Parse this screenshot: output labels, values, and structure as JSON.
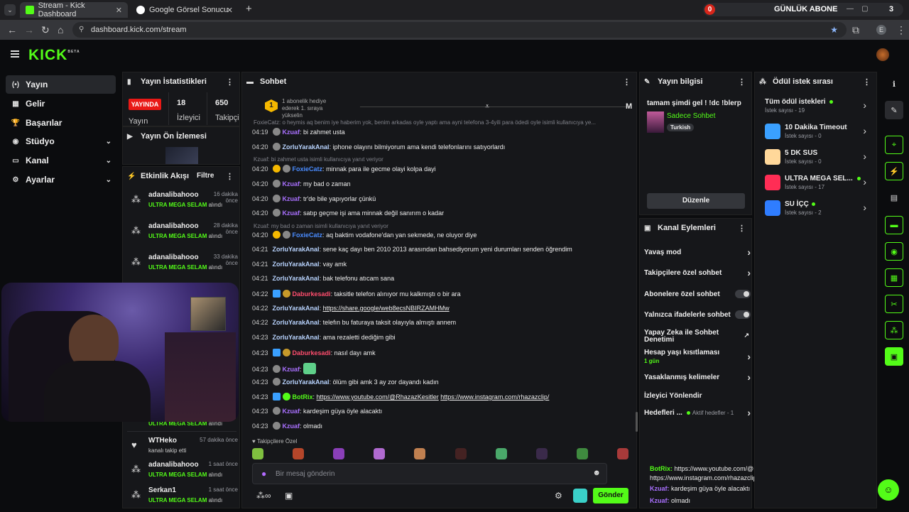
{
  "browser": {
    "tabs": [
      {
        "label": "Stream - Kick Dashboard",
        "close": "✕"
      },
      {
        "label": "Google Görsel Sonucu",
        "close": "✕"
      }
    ],
    "new_tab": "+",
    "goal_counter": "0",
    "goal_label": "GÜNLÜK ABONE",
    "goal_value": "3",
    "url": "dashboard.kick.com/stream",
    "profile_initial": "E"
  },
  "kick": {
    "logo": "KICK",
    "logo_sup": "BETA"
  },
  "leftnav": {
    "items": [
      {
        "label": "Yayın",
        "icon": "(•)",
        "chevron": ""
      },
      {
        "label": "Gelir",
        "icon": "▦",
        "chevron": ""
      },
      {
        "label": "Başarılar",
        "icon": "🏆",
        "chevron": ""
      },
      {
        "label": "Stüdyo",
        "icon": "◉",
        "chevron": "⌄"
      },
      {
        "label": "Kanal",
        "icon": "▭",
        "chevron": "⌄"
      },
      {
        "label": "Ayarlar",
        "icon": "⚙",
        "chevron": "⌄"
      }
    ]
  },
  "stats": {
    "title": "Yayın İstatistikleri",
    "live_badge": "YAYINDA",
    "live_label": "Yayın",
    "viewers": "18",
    "viewers_label": "İzleyici",
    "followers": "650",
    "followers_label": "Takipçi"
  },
  "preview": {
    "title": "Yayın Ön İzlemesi"
  },
  "activity": {
    "title": "Etkinlik Akışı",
    "filter": "Filtre",
    "items": [
      {
        "user": "adanalibahooo",
        "time": "16 dakika önce",
        "reward": "ULTRA MEGA SELAM",
        "suffix": " alındı"
      },
      {
        "user": "adanalibahooo",
        "time": "28 dakika önce",
        "reward": "ULTRA MEGA SELAM",
        "suffix": " alındı"
      },
      {
        "user": "adanalibahooo",
        "time": "33 dakika önce",
        "reward": "ULTRA MEGA SELAM",
        "suffix": " alındı"
      }
    ],
    "partial_reward": "ULTRA MEGA SELAM",
    "partial_suffix": " alındı",
    "follow": {
      "user": "WTHeko",
      "time": "57 dakika önce",
      "text": "kanalı takip etti"
    },
    "items2": [
      {
        "user": "adanalibahooo",
        "time": "1 saat önce",
        "reward": "ULTRA MEGA SELAM",
        "suffix": " alındı"
      },
      {
        "user": "Serkan1",
        "time": "1 saat önce",
        "reward": "ULTRA MEGA SELAM",
        "suffix": " alındı"
      }
    ]
  },
  "chat": {
    "title": "Sohbet",
    "pinned": {
      "rank": "1",
      "text": "1 abonelik hediye ederek 1. sıraya yükselin",
      "letter": "M"
    },
    "top_reply": "FoxieCatz: o heymis aq benim iye haberim yok, benim arkadas oyle yaptı ama ayni telefona 3-4yili para ödedi oyle isimli kullanıcıya ye...",
    "lines": [
      {
        "time": "04:19",
        "user": "Kzuaf",
        "color": "#a970ff",
        "text": "bi zahmet usta"
      },
      {
        "time": "04:20",
        "user": "ZorluYarakAnal",
        "color": "#b9d4ff",
        "text": "iphone olayını bilmiyorum ama kendi telefonlarını satıyorlardı"
      },
      {
        "time": "04:20",
        "user": "FoxieCatz",
        "color": "#4a8cff",
        "text": "minnak para ile gecme olayi kolpa dayi",
        "reply": "Kzuaf: bi zahmet usta isimli kullanıcıya yanıt veriyor"
      },
      {
        "time": "04:20",
        "user": "Kzuaf",
        "color": "#a970ff",
        "text": "my bad o zaman"
      },
      {
        "time": "04:20",
        "user": "Kzuaf",
        "color": "#a970ff",
        "text": "tr'de bile yapıyorlar çünkü"
      },
      {
        "time": "04:20",
        "user": "Kzuaf",
        "color": "#a970ff",
        "text": "satıp geçme işi ama minnak değil sanırım o kadar"
      },
      {
        "time": "04:20",
        "user": "FoxieCatz",
        "color": "#4a8cff",
        "text": "aq baktim vodafone'dan yan sekmede, ne oluyor diye",
        "reply": "Kzuaf: my bad o zaman isimli kullanıcıya yanıt veriyor"
      },
      {
        "time": "04:21",
        "user": "ZorluYarakAnal",
        "color": "#b9d4ff",
        "text": "sene kaç dayı ben 2010 2013 arasından bahsediyorum yeni durumları senden öğrendim"
      },
      {
        "time": "04:21",
        "user": "ZorluYarakAnal",
        "color": "#b9d4ff",
        "text": "vay amk"
      },
      {
        "time": "04:21",
        "user": "ZorluYarakAnal",
        "color": "#b9d4ff",
        "text": "bak telefonu atıcam sana"
      },
      {
        "time": "04:22",
        "user": "Daburkesadi",
        "color": "#ff4d6d",
        "text": "taksitle telefon alınıyor mu kalkmıştı o bir ara"
      },
      {
        "time": "04:22",
        "user": "ZorluYarakAnal",
        "color": "#b9d4ff",
        "text": "",
        "link": "https://share.google/web8ecsNBIRZAMHMw"
      },
      {
        "time": "04:22",
        "user": "ZorluYarakAnal",
        "color": "#b9d4ff",
        "text": "telefın bu faturaya taksit olayıyla almıştı annem"
      },
      {
        "time": "04:23",
        "user": "ZorluYarakAnal",
        "color": "#b9d4ff",
        "text": "ama rezaletti dediğim gibi"
      },
      {
        "time": "04:23",
        "user": "Daburkesadi",
        "color": "#ff4d6d",
        "text": "nasıl dayı amk"
      },
      {
        "time": "04:23",
        "user": "Kzuaf",
        "color": "#a970ff",
        "text": "",
        "emote": true
      },
      {
        "time": "04:23",
        "user": "ZorluYarakAnal",
        "color": "#b9d4ff",
        "text": "ölüm gibi amk 3 ay zor dayandı kadın"
      },
      {
        "time": "04:23",
        "user": "BotRix",
        "color": "#53fc18",
        "text": "",
        "link": "https://www.youtube.com/@RhazazKesitler",
        "link2": "https://www.instagram.com/rhazazclip/"
      },
      {
        "time": "04:23",
        "user": "Kzuaf",
        "color": "#a970ff",
        "text": "kardeşim güya öyle alacaktı"
      },
      {
        "time": "04:23",
        "user": "Kzuaf",
        "color": "#a970ff",
        "text": "olmadı"
      }
    ],
    "emote_section": "Takipçilere Özel",
    "placeholder": "Bir mesaj gönderin",
    "send": "Gönder"
  },
  "streaminfo": {
    "title": "Yayın bilgisi",
    "stream_title": "tamam şimdi gel ! !dc !blerp",
    "category": "Sadece Sohbet",
    "tag": "Turkish",
    "edit": "Düzenle"
  },
  "actions": {
    "title": "Kanal Eylemleri",
    "items": [
      {
        "label": "Yavaş mod",
        "type": "chev"
      },
      {
        "label": "Takipçilere özel sohbet",
        "type": "chev"
      },
      {
        "label": "Abonelere özel sohbet",
        "type": "toggle"
      },
      {
        "label": "Yalnızca ifadelerle sohbet",
        "type": "toggle"
      },
      {
        "label": "Yapay Zeka ile Sohbet Denetimi",
        "type": "ext"
      },
      {
        "label": "Hesap yaşı kısıtlaması",
        "sub": "1 gün",
        "type": "chev"
      },
      {
        "label": "Yasaklanmış kelimeler",
        "type": "chev"
      },
      {
        "label": "İzleyici Yönlendir",
        "type": "none"
      },
      {
        "label": "Hedefleri ...",
        "sub_inline": "Aktif hedefler - 1",
        "type": "chev"
      }
    ]
  },
  "rewards": {
    "title": "Ödül istek sırası",
    "all": {
      "label": "Tüm ödül istekleri",
      "count": "İstek sayısı - 19"
    },
    "items": [
      {
        "label": "10 Dakika Timeout",
        "count": "İstek sayısı - 0",
        "color": "#3aa0ff"
      },
      {
        "label": "5 DK SUS",
        "count": "İstek sayısı - 0",
        "color": "#ffd89a"
      },
      {
        "label": "ULTRA MEGA SEL...",
        "count": "İstek sayısı - 17",
        "color": "#ff2d55",
        "dot": true
      },
      {
        "label": "SU İÇÇ",
        "count": "İstek sayısı - 2",
        "color": "#2f7dff",
        "dot": true
      }
    ]
  },
  "overlay": {
    "bot": "BotRix:",
    "bot_text": "https://www.youtube.com/@RhazazKesitler https://www.instagram.com/rhazazclip/",
    "l1_user": "Kzuaf:",
    "l1_text": "kardeşim güya öyle alacaktı",
    "l2_user": "Kzuaf:",
    "l2_text": "olmadı"
  },
  "colors": {
    "accent": "#53fc18",
    "live": "#e91916",
    "bg": "#0b0c0e",
    "panel": "#16171a"
  }
}
